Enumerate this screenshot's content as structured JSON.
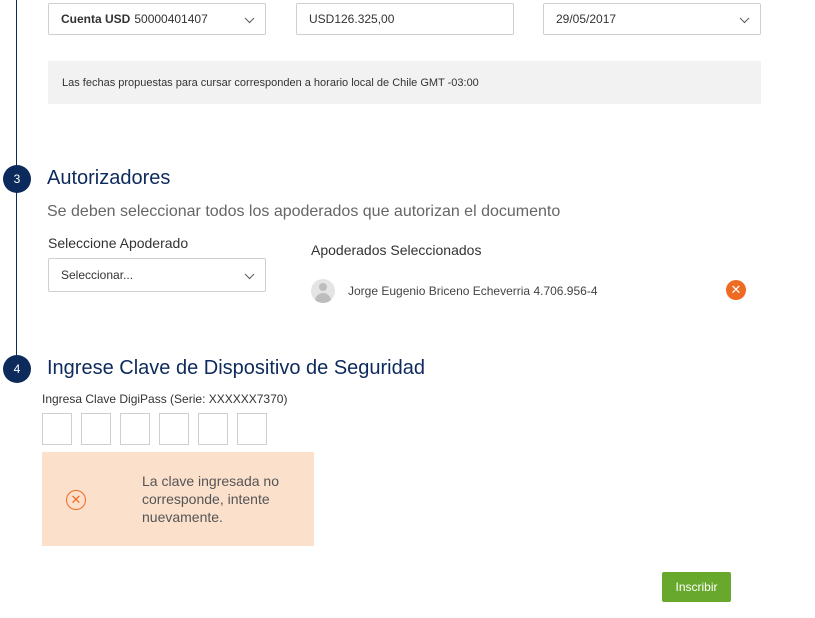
{
  "row1": {
    "account_label_bold": "Cuenta USD",
    "account_number": "50000401407",
    "amount_value": "USD126.325,00",
    "date_value": "29/05/2017"
  },
  "notice_text": "Las fechas propuestas para cursar corresponden a horario local de Chile GMT -03:00",
  "step3": {
    "number": "3",
    "title": "Autorizadores",
    "subtitle": "Se deben seleccionar todos los apoderados que autorizan el documento",
    "select_label": "Seleccione Apoderado",
    "select_placeholder": "Seleccionar...",
    "selected_heading": "Apoderados Seleccionados",
    "selected": [
      {
        "name": "Jorge Eugenio Briceno Echeverria 4.706.956-4"
      }
    ],
    "remove_glyph": "✕"
  },
  "step4": {
    "number": "4",
    "title": "Ingrese Clave de Dispositivo de Seguridad",
    "digipass_label": "Ingresa Clave DigiPass (Serie: XXXXXX7370)",
    "digit_count": 6,
    "error_glyph": "✕",
    "error_message": "La clave ingresada no corresponde, intente nuevamente."
  },
  "submit_label": "Inscribir",
  "colors": {
    "primary_navy": "#0d2a5c",
    "accent_orange": "#ef6a22",
    "error_bg": "#fbe0cc",
    "submit_green": "#68a92d"
  },
  "icons": [
    "chevron-down-icon",
    "avatar-icon",
    "remove-icon",
    "error-x-icon"
  ]
}
